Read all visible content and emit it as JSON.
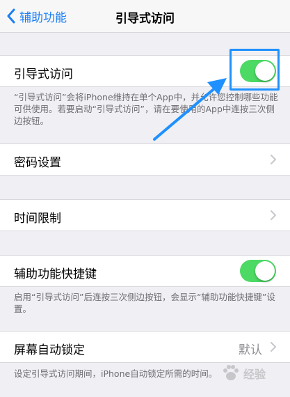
{
  "navbar": {
    "back_label": "辅助功能",
    "title": "引导式访问"
  },
  "guided_access": {
    "label": "引导式访问",
    "toggle_on": true,
    "footnote": "“引导式访问”会将iPhone维持在单个App中，并允许您控制哪些功能可供使用。若要启动“引导式访问”，请在要使用的App中连按三次侧边按钮。"
  },
  "passcode": {
    "label": "密码设置"
  },
  "time_limits": {
    "label": "时间限制"
  },
  "accessibility_shortcut": {
    "label": "辅助功能快捷键",
    "toggle_on": true,
    "footnote": "启用“引导式访问”后连按三次侧边按钮，会显示“辅助功能快捷键”设置。"
  },
  "auto_lock": {
    "label": "屏幕自动锁定",
    "value": "默认",
    "footnote": "设定引导式访问期间，iPhone自动锁定所需的时间。"
  },
  "watermark": {
    "text": "经验"
  },
  "colors": {
    "accent": "#1a7ff5",
    "toggle_on": "#4cd964",
    "annotation": "#1e90ff"
  }
}
